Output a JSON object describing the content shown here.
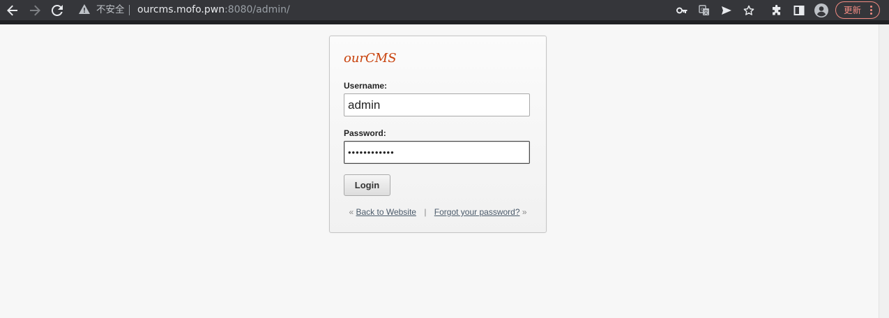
{
  "browser": {
    "address_bar": {
      "security_label": "不安全",
      "url_host": "ourcms.mofo.pwn",
      "url_rest": ":8080/admin/"
    },
    "update_button_label": "更新",
    "icons": {
      "back": "arrow-left-icon",
      "forward": "arrow-right-icon",
      "reload": "reload-icon",
      "warning": "warning-triangle-icon",
      "key": "key-icon",
      "translate": "translate-icon",
      "send": "send-icon",
      "bookmark": "star-icon",
      "extensions": "puzzle-icon",
      "side_panel": "side-panel-icon",
      "profile": "profile-avatar-icon",
      "menu": "three-dots-icon"
    }
  },
  "login": {
    "brand": "ourCMS",
    "username_label": "Username:",
    "username_value": "admin",
    "password_label": "Password:",
    "password_value": "••••••••••••",
    "login_button": "Login",
    "footer": {
      "open_quote": "«",
      "back_link": "Back to Website",
      "separator": "|",
      "forgot_link": "Forgot your password?",
      "close_quote": "»"
    }
  },
  "colors": {
    "brand": "#c8410b",
    "toolbar": "#35363a",
    "update_accent": "#f28b82",
    "page_background": "#f7f7f7"
  }
}
